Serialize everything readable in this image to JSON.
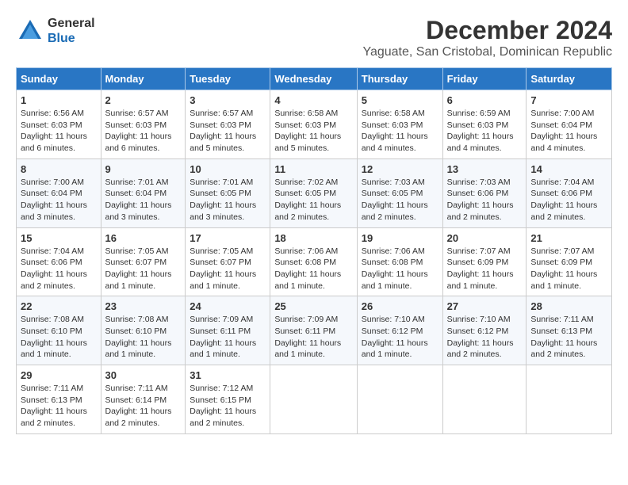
{
  "logo": {
    "line1": "General",
    "line2": "Blue"
  },
  "title": "December 2024",
  "location": "Yaguate, San Cristobal, Dominican Republic",
  "days_of_week": [
    "Sunday",
    "Monday",
    "Tuesday",
    "Wednesday",
    "Thursday",
    "Friday",
    "Saturday"
  ],
  "weeks": [
    [
      {
        "day": "1",
        "sunrise": "6:56 AM",
        "sunset": "6:03 PM",
        "daylight": "11 hours and 6 minutes."
      },
      {
        "day": "2",
        "sunrise": "6:57 AM",
        "sunset": "6:03 PM",
        "daylight": "11 hours and 6 minutes."
      },
      {
        "day": "3",
        "sunrise": "6:57 AM",
        "sunset": "6:03 PM",
        "daylight": "11 hours and 5 minutes."
      },
      {
        "day": "4",
        "sunrise": "6:58 AM",
        "sunset": "6:03 PM",
        "daylight": "11 hours and 5 minutes."
      },
      {
        "day": "5",
        "sunrise": "6:58 AM",
        "sunset": "6:03 PM",
        "daylight": "11 hours and 4 minutes."
      },
      {
        "day": "6",
        "sunrise": "6:59 AM",
        "sunset": "6:03 PM",
        "daylight": "11 hours and 4 minutes."
      },
      {
        "day": "7",
        "sunrise": "7:00 AM",
        "sunset": "6:04 PM",
        "daylight": "11 hours and 4 minutes."
      }
    ],
    [
      {
        "day": "8",
        "sunrise": "7:00 AM",
        "sunset": "6:04 PM",
        "daylight": "11 hours and 3 minutes."
      },
      {
        "day": "9",
        "sunrise": "7:01 AM",
        "sunset": "6:04 PM",
        "daylight": "11 hours and 3 minutes."
      },
      {
        "day": "10",
        "sunrise": "7:01 AM",
        "sunset": "6:05 PM",
        "daylight": "11 hours and 3 minutes."
      },
      {
        "day": "11",
        "sunrise": "7:02 AM",
        "sunset": "6:05 PM",
        "daylight": "11 hours and 2 minutes."
      },
      {
        "day": "12",
        "sunrise": "7:03 AM",
        "sunset": "6:05 PM",
        "daylight": "11 hours and 2 minutes."
      },
      {
        "day": "13",
        "sunrise": "7:03 AM",
        "sunset": "6:06 PM",
        "daylight": "11 hours and 2 minutes."
      },
      {
        "day": "14",
        "sunrise": "7:04 AM",
        "sunset": "6:06 PM",
        "daylight": "11 hours and 2 minutes."
      }
    ],
    [
      {
        "day": "15",
        "sunrise": "7:04 AM",
        "sunset": "6:06 PM",
        "daylight": "11 hours and 2 minutes."
      },
      {
        "day": "16",
        "sunrise": "7:05 AM",
        "sunset": "6:07 PM",
        "daylight": "11 hours and 1 minute."
      },
      {
        "day": "17",
        "sunrise": "7:05 AM",
        "sunset": "6:07 PM",
        "daylight": "11 hours and 1 minute."
      },
      {
        "day": "18",
        "sunrise": "7:06 AM",
        "sunset": "6:08 PM",
        "daylight": "11 hours and 1 minute."
      },
      {
        "day": "19",
        "sunrise": "7:06 AM",
        "sunset": "6:08 PM",
        "daylight": "11 hours and 1 minute."
      },
      {
        "day": "20",
        "sunrise": "7:07 AM",
        "sunset": "6:09 PM",
        "daylight": "11 hours and 1 minute."
      },
      {
        "day": "21",
        "sunrise": "7:07 AM",
        "sunset": "6:09 PM",
        "daylight": "11 hours and 1 minute."
      }
    ],
    [
      {
        "day": "22",
        "sunrise": "7:08 AM",
        "sunset": "6:10 PM",
        "daylight": "11 hours and 1 minute."
      },
      {
        "day": "23",
        "sunrise": "7:08 AM",
        "sunset": "6:10 PM",
        "daylight": "11 hours and 1 minute."
      },
      {
        "day": "24",
        "sunrise": "7:09 AM",
        "sunset": "6:11 PM",
        "daylight": "11 hours and 1 minute."
      },
      {
        "day": "25",
        "sunrise": "7:09 AM",
        "sunset": "6:11 PM",
        "daylight": "11 hours and 1 minute."
      },
      {
        "day": "26",
        "sunrise": "7:10 AM",
        "sunset": "6:12 PM",
        "daylight": "11 hours and 1 minute."
      },
      {
        "day": "27",
        "sunrise": "7:10 AM",
        "sunset": "6:12 PM",
        "daylight": "11 hours and 2 minutes."
      },
      {
        "day": "28",
        "sunrise": "7:11 AM",
        "sunset": "6:13 PM",
        "daylight": "11 hours and 2 minutes."
      }
    ],
    [
      {
        "day": "29",
        "sunrise": "7:11 AM",
        "sunset": "6:13 PM",
        "daylight": "11 hours and 2 minutes."
      },
      {
        "day": "30",
        "sunrise": "7:11 AM",
        "sunset": "6:14 PM",
        "daylight": "11 hours and 2 minutes."
      },
      {
        "day": "31",
        "sunrise": "7:12 AM",
        "sunset": "6:15 PM",
        "daylight": "11 hours and 2 minutes."
      },
      null,
      null,
      null,
      null
    ]
  ]
}
